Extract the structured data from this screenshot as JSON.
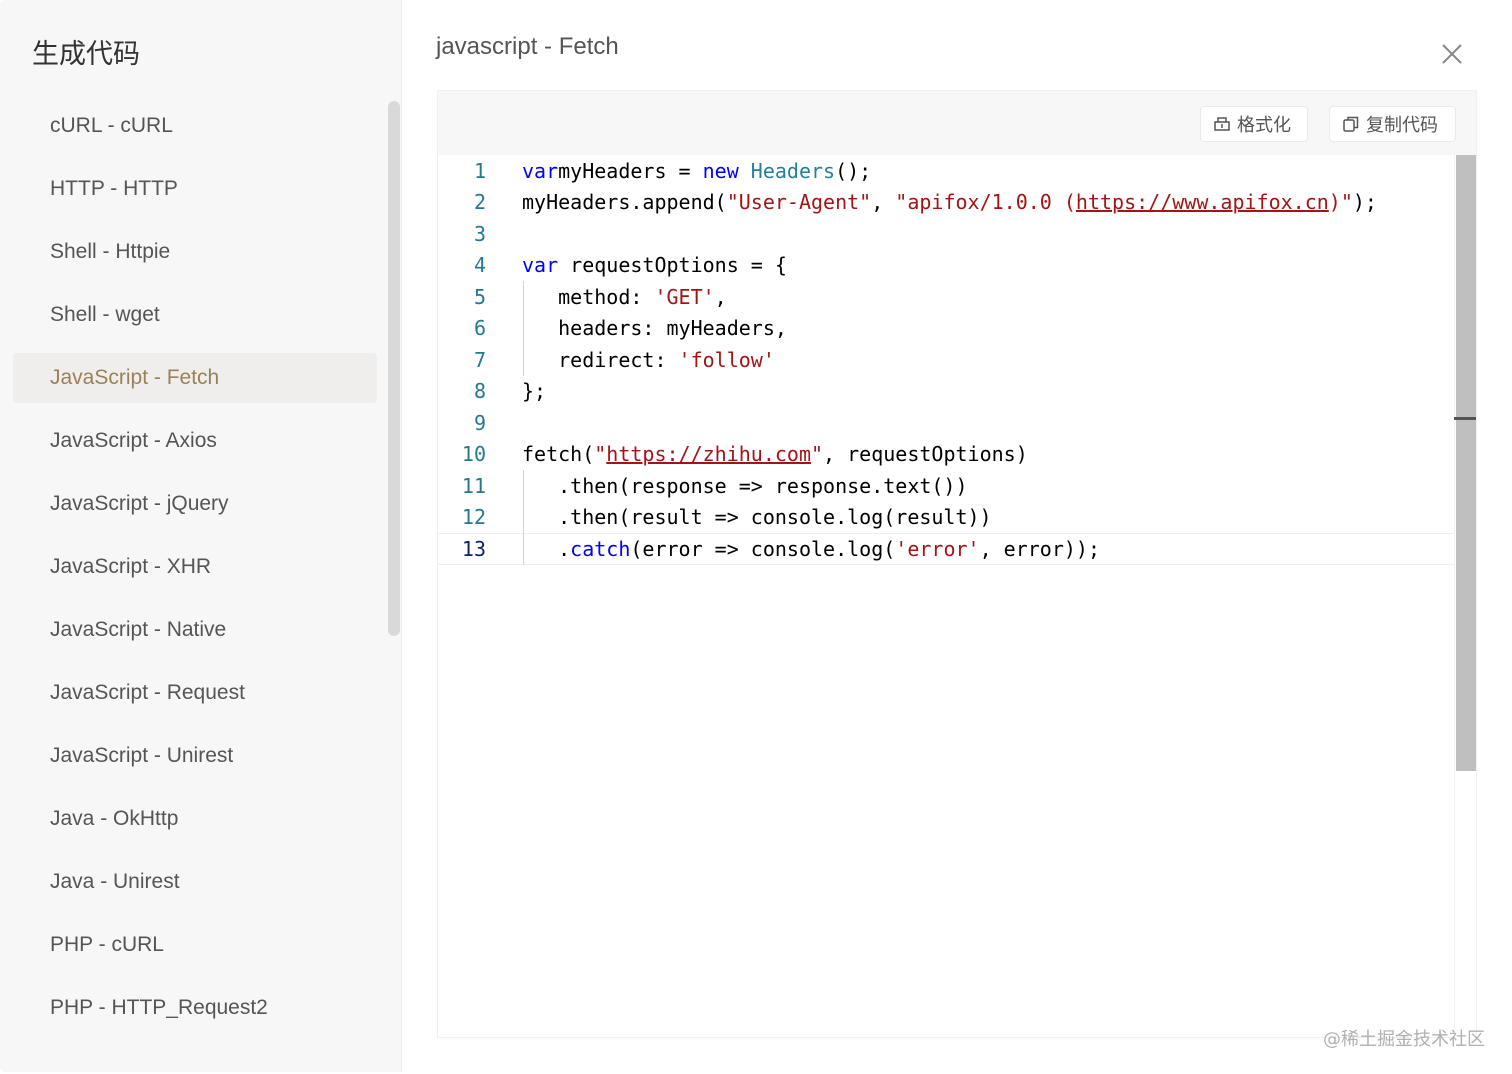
{
  "sidebar": {
    "title": "生成代码",
    "items": [
      {
        "label": "cURL - cURL"
      },
      {
        "label": "HTTP - HTTP"
      },
      {
        "label": "Shell - Httpie"
      },
      {
        "label": "Shell - wget"
      },
      {
        "label": "JavaScript - Fetch",
        "active": true
      },
      {
        "label": "JavaScript - Axios"
      },
      {
        "label": "JavaScript - jQuery"
      },
      {
        "label": "JavaScript - XHR"
      },
      {
        "label": "JavaScript - Native"
      },
      {
        "label": "JavaScript - Request"
      },
      {
        "label": "JavaScript - Unirest"
      },
      {
        "label": "Java - OkHttp"
      },
      {
        "label": "Java - Unirest"
      },
      {
        "label": "PHP - cURL"
      },
      {
        "label": "PHP - HTTP_Request2"
      }
    ]
  },
  "main": {
    "title": "javascript - Fetch",
    "close_icon": "close-icon"
  },
  "toolbar": {
    "format_label": "格式化",
    "copy_label": "复制代码"
  },
  "code": {
    "current_line": 13,
    "lines": [
      {
        "no": "1",
        "tokens": [
          [
            "kw",
            "var"
          ],
          [
            "",
            "myHeaders = "
          ],
          [
            "kw",
            "new"
          ],
          [
            "",
            " "
          ],
          [
            "cls",
            "Headers"
          ],
          [
            "",
            "();"
          ]
        ]
      },
      {
        "no": "2",
        "tokens": [
          [
            "",
            "myHeaders.append("
          ],
          [
            "str",
            "\"User-Agent\""
          ],
          [
            "",
            ", "
          ],
          [
            "str",
            "\"apifox/1.0.0 ("
          ],
          [
            "link",
            "https://www.apifox.cn"
          ],
          [
            "str",
            ")\""
          ],
          [
            "",
            ");"
          ]
        ]
      },
      {
        "no": "3",
        "tokens": []
      },
      {
        "no": "4",
        "tokens": [
          [
            "kw",
            "var"
          ],
          [
            "",
            " requestOptions = {"
          ]
        ]
      },
      {
        "no": "5",
        "tokens": [
          [
            "",
            "   method: "
          ],
          [
            "str",
            "'GET'"
          ],
          [
            "",
            ","
          ]
        ]
      },
      {
        "no": "6",
        "tokens": [
          [
            "",
            "   headers: myHeaders,"
          ]
        ]
      },
      {
        "no": "7",
        "tokens": [
          [
            "",
            "   redirect: "
          ],
          [
            "str",
            "'follow'"
          ]
        ]
      },
      {
        "no": "8",
        "tokens": [
          [
            "",
            "};"
          ]
        ]
      },
      {
        "no": "9",
        "tokens": []
      },
      {
        "no": "10",
        "tokens": [
          [
            "",
            "fetch("
          ],
          [
            "str",
            "\""
          ],
          [
            "link",
            "https://zhihu.com"
          ],
          [
            "str",
            "\""
          ],
          [
            "",
            ", requestOptions)"
          ]
        ]
      },
      {
        "no": "11",
        "tokens": [
          [
            "",
            "   .then(response => response.text())"
          ]
        ]
      },
      {
        "no": "12",
        "tokens": [
          [
            "",
            "   .then(result => console.log(result))"
          ]
        ]
      },
      {
        "no": "13",
        "tokens": [
          [
            "",
            "   ."
          ],
          [
            "kw",
            "catch"
          ],
          [
            "",
            "(error => console.log("
          ],
          [
            "str",
            "'error'"
          ],
          [
            "",
            ", error));"
          ]
        ]
      }
    ]
  },
  "watermark": "@稀土掘金技术社区",
  "colors": {
    "keyword": "#0000ff",
    "string": "#a31515",
    "class": "#267f99",
    "line_number": "#237893",
    "active_item_text": "#9b8156"
  }
}
